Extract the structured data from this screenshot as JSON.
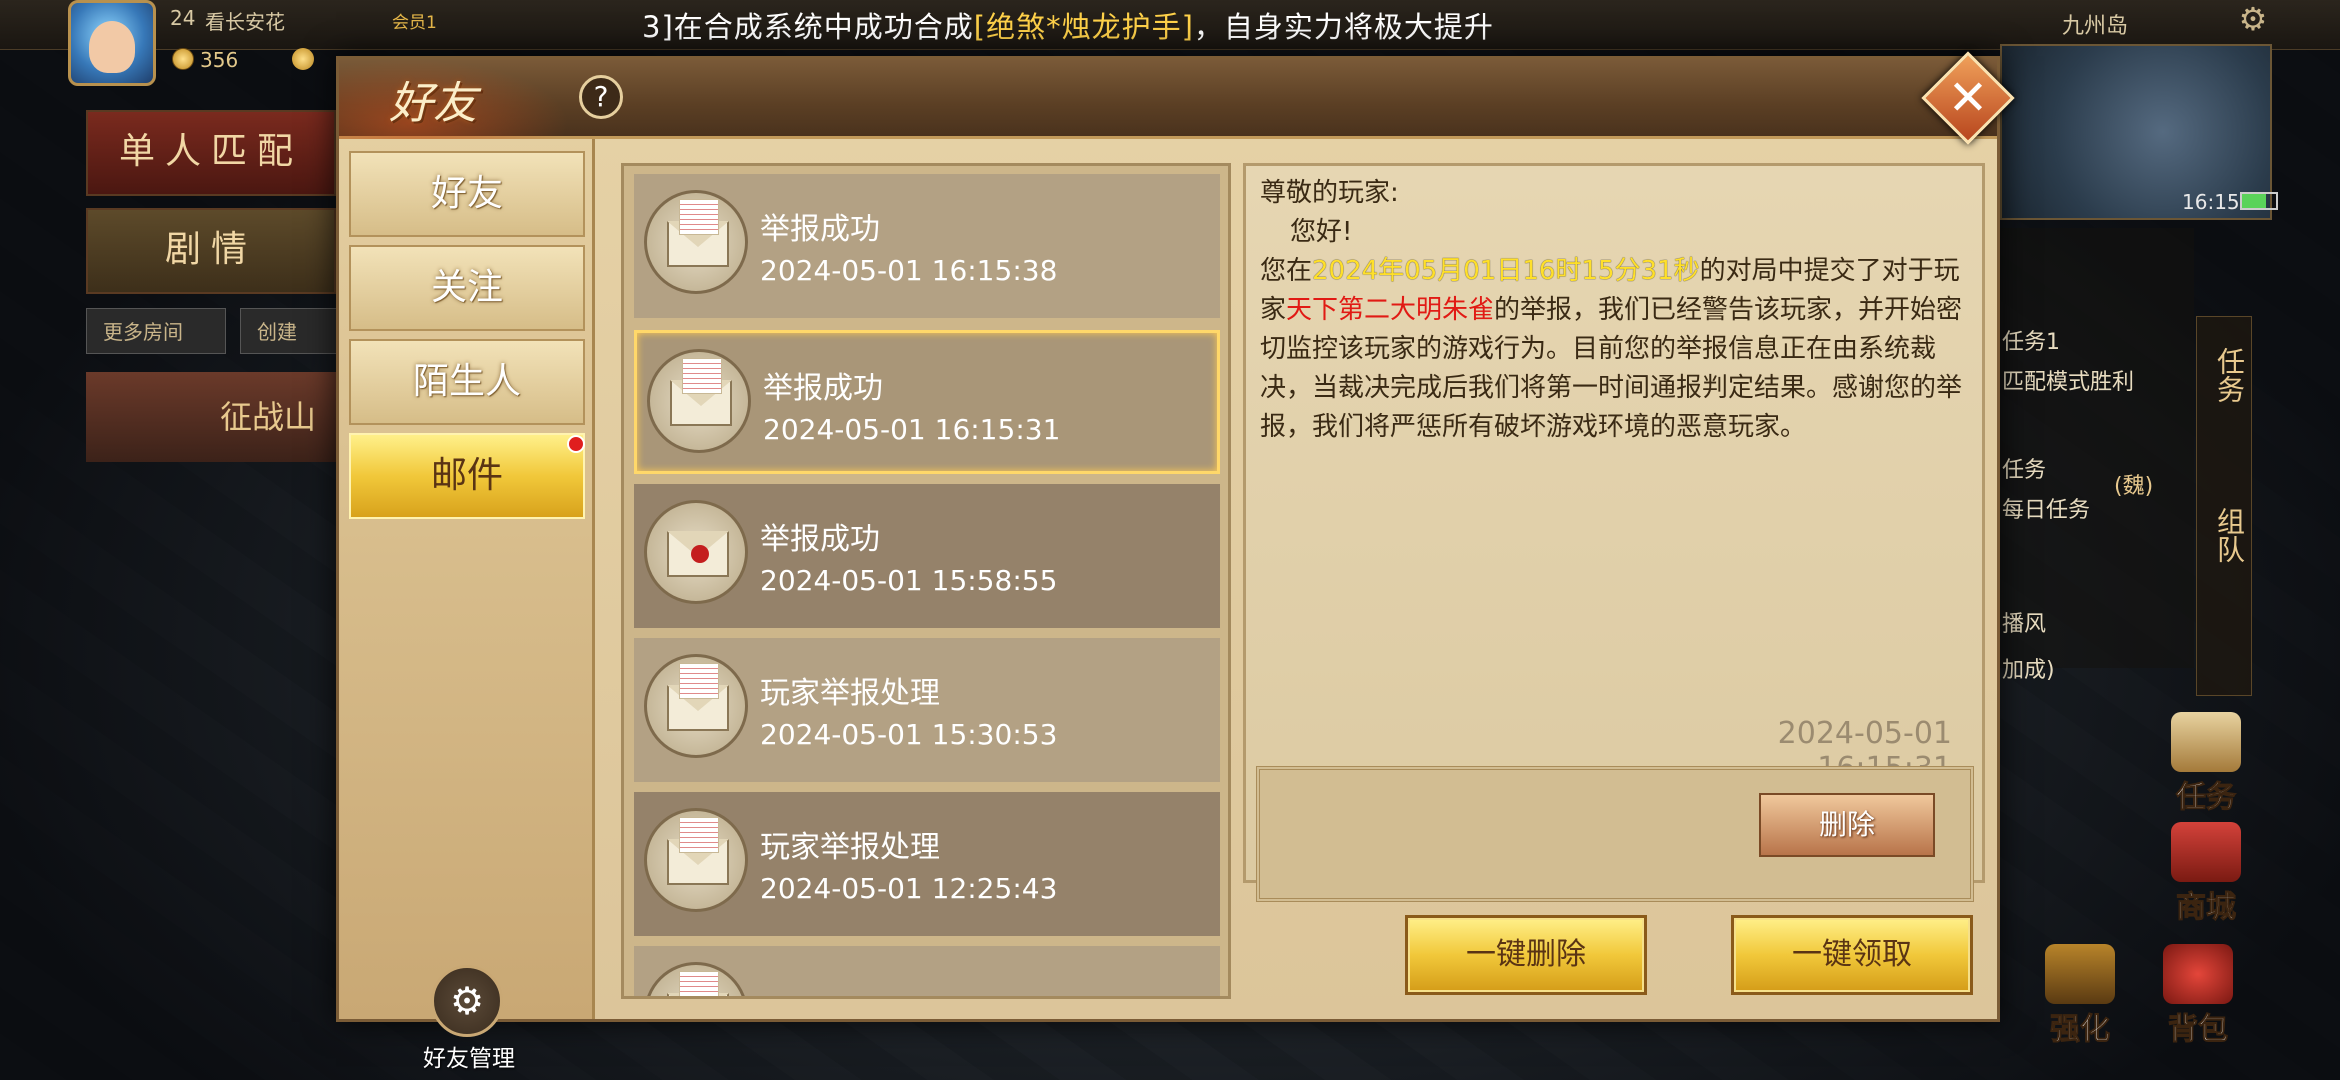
{
  "hud": {
    "level": "24",
    "player_name": "看长安花",
    "vip": "会员1",
    "gold": "356",
    "announcement_prefix": "3]在合成系统中成功合成",
    "announcement_item": "[绝煞*烛龙护手]",
    "announcement_suffix": "，自身实力将极大提升",
    "map_name": "九州岛",
    "clock": "16:15"
  },
  "background": {
    "solo_match": "单人匹配",
    "story": "剧情",
    "more_rooms": "更多房间",
    "create_room": "创建",
    "campaign": "征战山",
    "tasks": [
      "任务1",
      "匹配模式胜利",
      "任务",
      "每日任务",
      "(魏)",
      "播风",
      "加成)"
    ],
    "right_tabs": [
      "任务",
      "组队"
    ],
    "buttons": [
      "任务",
      "商城",
      "强化",
      "背包"
    ]
  },
  "dialog": {
    "title": "好友",
    "help": "?",
    "close": "✕",
    "nav": [
      {
        "label": "好友"
      },
      {
        "label": "关注"
      },
      {
        "label": "陌生人"
      },
      {
        "label": "邮件"
      }
    ],
    "friend_manage": "好友管理",
    "mails": [
      {
        "title": "举报成功",
        "time": "2024-05-01 16:15:38",
        "opened": true
      },
      {
        "title": "举报成功",
        "time": "2024-05-01 16:15:31",
        "opened": true,
        "selected": true
      },
      {
        "title": "举报成功",
        "time": "2024-05-01 15:58:55",
        "opened": false
      },
      {
        "title": "玩家举报处理",
        "time": "2024-05-01 15:30:53",
        "opened": true
      },
      {
        "title": "玩家举报处理",
        "time": "2024-05-01 12:25:43",
        "opened": true
      }
    ],
    "detail": {
      "greeting": "尊敬的玩家:",
      "hello": "您好!",
      "p1": "您在",
      "date_highlight": "2024年05月01日16时15分31秒",
      "p2": "的对局中提交了对于玩家",
      "reported_player": "天下第二大明朱雀",
      "p3": "的举报，我们已经警告该玩家，并开始密切监控该玩家的游戏行为。目前您的举报信息正在由系统裁决，当裁决完成后我们将第一时间通报判定结果。感谢您的举报，我们将严惩所有破坏游戏环境的恶意玩家。",
      "time": "2024-05-01 16:15:31"
    },
    "delete_label": "删除",
    "delete_all_label": "一键删除",
    "claim_all_label": "一键领取"
  }
}
